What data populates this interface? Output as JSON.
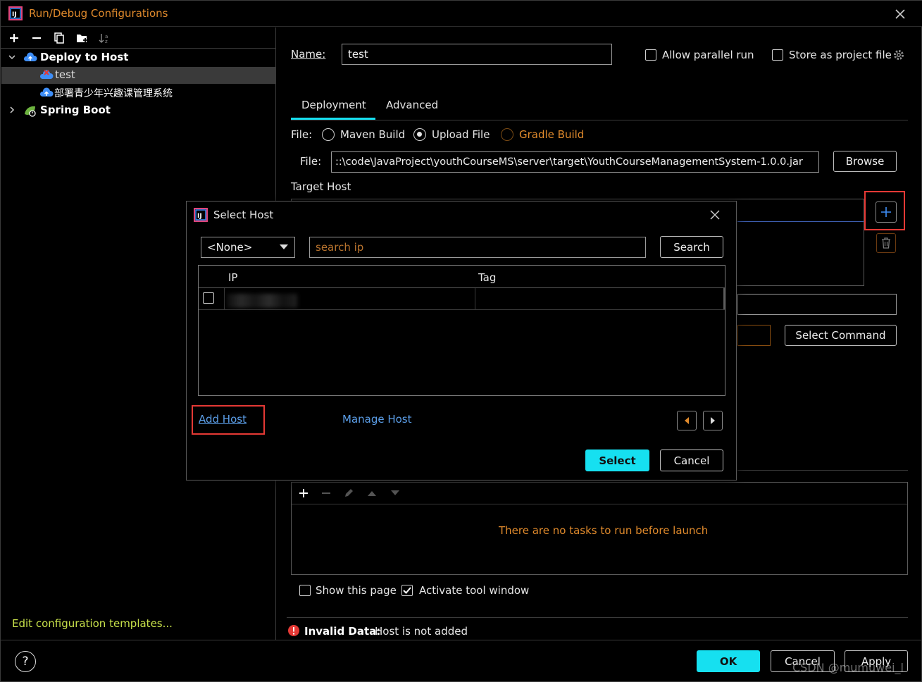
{
  "window": {
    "title": "Run/Debug Configurations"
  },
  "toolbar": {
    "icons": [
      "plus-icon",
      "minus-icon",
      "copy-icon",
      "new-folder-icon",
      "sort-alpha-icon"
    ]
  },
  "tree": {
    "items": [
      {
        "label": "Deploy to Host",
        "bold": true
      },
      {
        "label": "test"
      },
      {
        "label": "部署青少年兴趣课管理系统"
      },
      {
        "label": "Spring Boot",
        "bold": true
      }
    ],
    "edit_templates": "Edit configuration templates..."
  },
  "form": {
    "name_label": "Name:",
    "name_value": "test",
    "allow_parallel": "Allow parallel run",
    "store_as_project": "Store as project file",
    "tabs": [
      "Deployment",
      "Advanced"
    ],
    "file_label": "File:",
    "radio_maven": "Maven Build",
    "radio_upload": "Upload File",
    "radio_gradle": "Gradle Build",
    "file_path_label": "File:",
    "file_path_value": "::\\code\\JavaProject\\youthCourseMS\\server\\target\\YouthCourseManagementSystem-1.0.0.jar",
    "browse": "Browse",
    "target_host": "Target Host",
    "select_command": "Select Command",
    "no_tasks": "There are no tasks to run before launch",
    "show_page": "Show this page",
    "activate_tool": "Activate tool window",
    "error_title": "Invalid Data:",
    "error_text": "Host is not added"
  },
  "footer": {
    "help": "?",
    "ok": "OK",
    "cancel": "Cancel",
    "apply": "Apply",
    "watermark": "CSDN @mumuwei_l"
  },
  "dialog": {
    "title": "Select Host",
    "dropdown": "<None>",
    "search_placeholder": "search ip",
    "search_btn": "Search",
    "col_ip": "IP",
    "col_tag": "Tag",
    "add_host": "Add Host",
    "manage_host": "Manage Host",
    "select": "Select",
    "cancel": "Cancel"
  },
  "colors": {
    "accent": "#16e0f0",
    "orange": "#e08a2c",
    "error": "#e53935",
    "link": "#5b9ee8"
  }
}
